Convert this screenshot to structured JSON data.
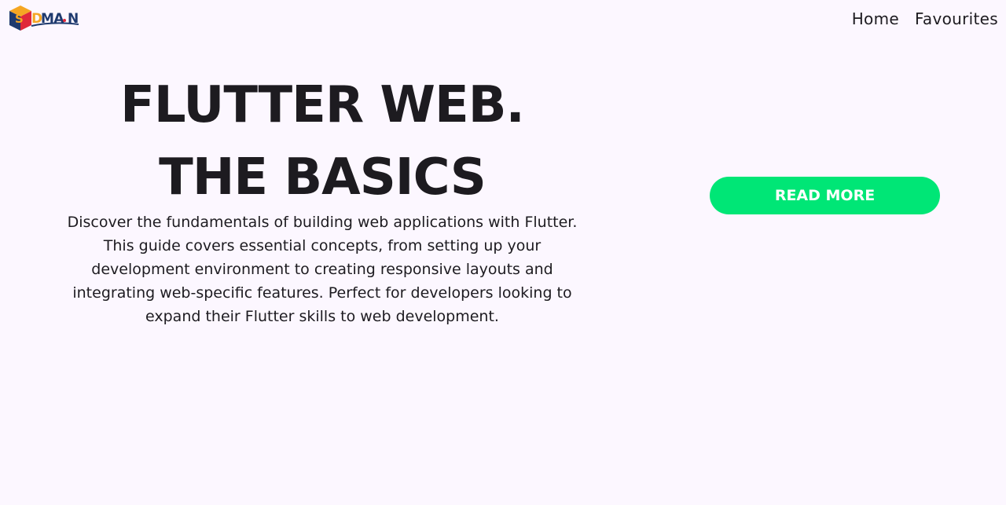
{
  "header": {
    "logo_text": "SDMAN",
    "nav": [
      {
        "label": "Home"
      },
      {
        "label": "Favourites"
      }
    ]
  },
  "hero": {
    "title_line1": "FLUTTER WEB.",
    "title_line2": "THE BASICS",
    "description": "Discover the fundamentals of building web applications with Flutter. This guide covers essential concepts, from setting up your development environment to creating responsive layouts and integrating web-specific features. Perfect for developers looking to expand their Flutter skills to web development.",
    "cta_label": "READ MORE"
  },
  "colors": {
    "background": "#fcf7ff",
    "text": "#1d1b20",
    "cta": "#00e676",
    "logo_orange": "#f5a623",
    "logo_navy": "#1e3a6e",
    "logo_red": "#e0283a"
  }
}
